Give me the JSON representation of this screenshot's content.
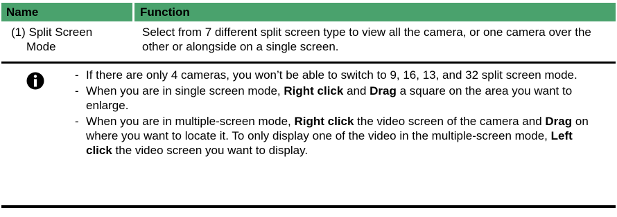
{
  "header": {
    "name": "Name",
    "function": "Function"
  },
  "row": {
    "name_line1": "(1) Split Screen",
    "name_line2": "Mode",
    "function": "Select from 7 different split screen type to view all the camera, or one camera over the other or alongside on a single screen."
  },
  "notes": {
    "icon": "info-icon",
    "dash": "-",
    "item1": "If there are only 4 cameras, you won’t be able to switch to 9, 16, 13, and 32 split screen mode.",
    "item2": {
      "t1": "When you are in single screen mode, ",
      "b1": "Right click",
      "t2": " and ",
      "b2": "Drag",
      "t3": " a square on the area you want to enlarge."
    },
    "item3": {
      "t1": "When you are in multiple-screen mode, ",
      "b1": "Right click",
      "t2": " the video screen of the camera and ",
      "b2": "Drag",
      "t3": " on where you want to locate it. To only display one of the video in the multiple-screen mode, ",
      "b3": "Left click",
      "t4": " the video screen you want to display."
    }
  },
  "colors": {
    "header_bg": "#4aa26d",
    "rule": "#000000"
  }
}
